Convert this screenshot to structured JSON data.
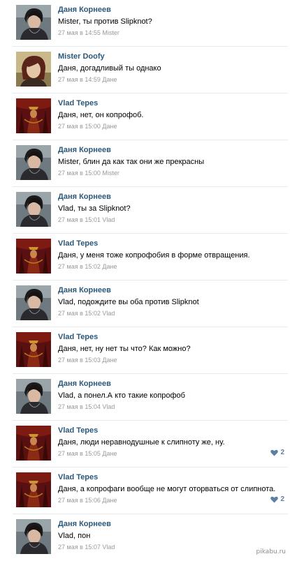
{
  "comments": [
    {
      "author": "Даня Корнеев",
      "avatar": "avatar-danya",
      "text": "Mister, ты против Slipknot?",
      "date": "27 мая в 14:55",
      "reply_to": "Mister",
      "likes": ""
    },
    {
      "author": "Mister Doofy",
      "avatar": "avatar-mister",
      "text": "Даня, догадливый ты однако",
      "date": "27 мая в 14:59",
      "reply_to": "Дане",
      "likes": ""
    },
    {
      "author": "Vlad Tepes",
      "avatar": "avatar-vlad",
      "text": "Даня, нет, он копрофоб.",
      "date": "27 мая в 15:00",
      "reply_to": "Дане",
      "likes": ""
    },
    {
      "author": "Даня Корнеев",
      "avatar": "avatar-danya",
      "text": "Mister, блин да как так они же прекрасны",
      "date": "27 мая в 15:00",
      "reply_to": "Mister",
      "likes": ""
    },
    {
      "author": "Даня Корнеев",
      "avatar": "avatar-danya",
      "text": "Vlad, ты за Slipknot?",
      "date": "27 мая в 15:01",
      "reply_to": "Vlad",
      "likes": ""
    },
    {
      "author": "Vlad Tepes",
      "avatar": "avatar-vlad",
      "text": "Даня, у меня тоже копрофобия в форме отвращения.",
      "date": "27 мая в 15:02",
      "reply_to": "Дане",
      "likes": ""
    },
    {
      "author": "Даня Корнеев",
      "avatar": "avatar-danya",
      "text": "Vlad, подождите вы оба против Slipknot",
      "date": "27 мая в 15:02",
      "reply_to": "Vlad",
      "likes": ""
    },
    {
      "author": "Vlad Tepes",
      "avatar": "avatar-vlad",
      "text": "Даня, нет, ну нет ты что? Как можно?",
      "date": "27 мая в 15:03",
      "reply_to": "Дане",
      "likes": ""
    },
    {
      "author": "Даня Корнеев",
      "avatar": "avatar-danya",
      "text": "Vlad, а понел.А кто такие копрофоб",
      "date": "27 мая в 15:04",
      "reply_to": "Vlad",
      "likes": ""
    },
    {
      "author": "Vlad Tepes",
      "avatar": "avatar-vlad",
      "text": "Даня, люди неравнодушные к слипноту же, ну.",
      "date": "27 мая в 15:05",
      "reply_to": "Дане",
      "likes": "2"
    },
    {
      "author": "Vlad Tepes",
      "avatar": "avatar-vlad",
      "text": "Даня, а копрофаги вообще не могут оторваться от слипнота.",
      "date": "27 мая в 15:06",
      "reply_to": "Дане",
      "likes": "2"
    },
    {
      "author": "Даня Корнеев",
      "avatar": "avatar-danya",
      "text": "Vlad, пон",
      "date": "27 мая в 15:07",
      "reply_to": "Vlad",
      "likes": ""
    }
  ],
  "like_icon": "heart-icon",
  "colors": {
    "author": "#2b587a",
    "meta": "#999999",
    "likes": "#5d7fa1",
    "separator": "#e7eaed"
  },
  "watermark": "pikabu.ru"
}
